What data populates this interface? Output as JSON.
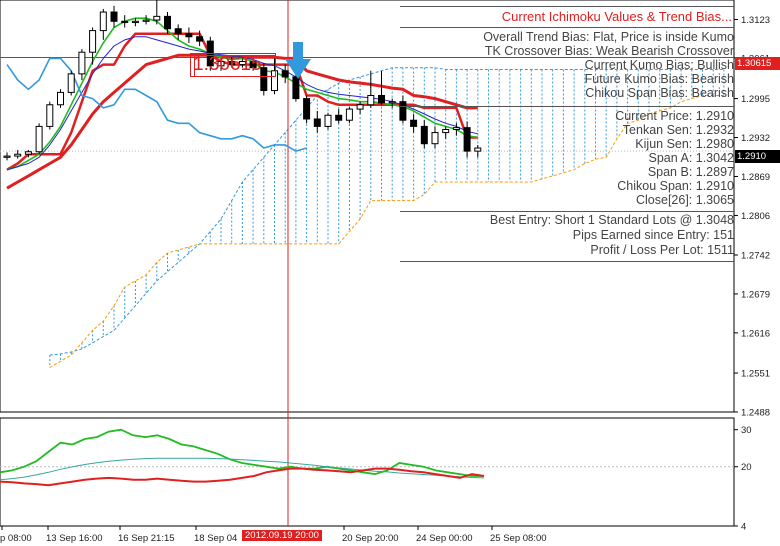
{
  "panel": {
    "title": "Current Ichimoku Values & Trend Bias...",
    "bias_lines": [
      "Overall Trend Bias: Flat, Price is inside Kumo",
      "TK Crossover Bias: Weak Bearish Crossover",
      "Current Kumo Bias: Bullish",
      "Future Kumo Bias: Bearish",
      "Chikou Span Bias: Bearish"
    ],
    "value_lines": [
      "Current Price: 1.2910",
      "Tenkan Sen: 1.2932",
      "Kijun Sen: 1.2980",
      "Span A: 1.3042",
      "Span B: 1.2897",
      "Chikou Span: 1.2910",
      "Close[26]: 1.3065"
    ],
    "entry_lines": [
      "Best Entry: Short 1 Standard Lots @ 1.3048",
      "Pips Earned since Entry: 151",
      "Profit / Loss Per Lot: 1511"
    ]
  },
  "entry_label": "1.30615",
  "crosshair_price": "1.30615",
  "current_price_tag": "1.2910",
  "crosshair_time": "2012.09.19 20:00",
  "colors": {
    "tenkan": "#e02020",
    "kijun": "#e02020",
    "green": "#22bb22",
    "blue": "#3399dd",
    "navy": "#2222cc",
    "kumo_span_a": "#3399dd",
    "kumo_span_b": "#ff9900",
    "crosshair": "#e02020"
  },
  "chart_data": [
    {
      "type": "candlestick",
      "y_axis_ticks": [
        1.3123,
        1.3061,
        1.2995,
        1.2932,
        1.2869,
        1.2806,
        1.2742,
        1.2679,
        1.2616,
        1.2551,
        1.2488
      ],
      "ylim": [
        1.2488,
        1.3148
      ],
      "x_axis_ticks": [
        "p 08:00",
        "13 Sep 16:00",
        "16 Sep 21:15",
        "18 Sep 04",
        "20 Sep 20:00",
        "24 Sep 00:00",
        "25 Sep 08:00"
      ],
      "candles": [
        [
          1.29,
          1.2908,
          1.2895,
          1.2902
        ],
        [
          1.2902,
          1.2912,
          1.2898,
          1.2905
        ],
        [
          1.2905,
          1.2912,
          1.29,
          1.2909
        ],
        [
          1.2909,
          1.2955,
          1.2905,
          1.295
        ],
        [
          1.295,
          1.299,
          1.2945,
          1.2985
        ],
        [
          1.2985,
          1.301,
          1.298,
          1.3005
        ],
        [
          1.3005,
          1.304,
          1.3,
          1.3035
        ],
        [
          1.3035,
          1.3075,
          1.3025,
          1.307
        ],
        [
          1.307,
          1.311,
          1.305,
          1.3105
        ],
        [
          1.3105,
          1.314,
          1.309,
          1.3135
        ],
        [
          1.3135,
          1.3145,
          1.311,
          1.312
        ],
        [
          1.312,
          1.313,
          1.311,
          1.3118
        ],
        [
          1.3118,
          1.3125,
          1.3112,
          1.312
        ],
        [
          1.312,
          1.313,
          1.3115,
          1.3122
        ],
        [
          1.3122,
          1.3155,
          1.3115,
          1.3128
        ],
        [
          1.3128,
          1.3135,
          1.31,
          1.3108
        ],
        [
          1.3108,
          1.3115,
          1.309,
          1.31
        ],
        [
          1.31,
          1.311,
          1.3085,
          1.3095
        ],
        [
          1.3095,
          1.3105,
          1.308,
          1.3088
        ],
        [
          1.3088,
          1.3095,
          1.304,
          1.3048
        ],
        [
          1.3048,
          1.306,
          1.304,
          1.3055
        ],
        [
          1.3055,
          1.3062,
          1.3045,
          1.305
        ],
        [
          1.305,
          1.306,
          1.3045,
          1.3055
        ],
        [
          1.3055,
          1.306,
          1.304,
          1.3045
        ],
        [
          1.3045,
          1.3052,
          1.3,
          1.3008
        ],
        [
          1.3008,
          1.306,
          1.3002,
          1.304
        ],
        [
          1.304,
          1.305,
          1.302,
          1.303
        ],
        [
          1.303,
          1.3035,
          1.299,
          1.2995
        ],
        [
          1.2995,
          1.3,
          1.2955,
          1.2962
        ],
        [
          1.2962,
          1.2975,
          1.294,
          1.295
        ],
        [
          1.295,
          1.2972,
          1.2945,
          1.2968
        ],
        [
          1.2968,
          1.2978,
          1.2955,
          1.296
        ],
        [
          1.296,
          1.2982,
          1.2955,
          1.2978
        ],
        [
          1.2978,
          1.299,
          1.297,
          1.2985
        ],
        [
          1.2985,
          1.304,
          1.298,
          1.3
        ],
        [
          1.3,
          1.304,
          1.2985,
          1.2988
        ],
        [
          1.2988,
          1.2995,
          1.298,
          1.299
        ],
        [
          1.299,
          1.3,
          1.2955,
          1.296
        ],
        [
          1.296,
          1.297,
          1.294,
          1.295
        ],
        [
          1.295,
          1.296,
          1.2915,
          1.2922
        ],
        [
          1.2922,
          1.295,
          1.2915,
          1.294
        ],
        [
          1.294,
          1.295,
          1.293,
          1.2945
        ],
        [
          1.2945,
          1.2955,
          1.2935,
          1.2948
        ],
        [
          1.2948,
          1.2958,
          1.29,
          1.291
        ],
        [
          1.291,
          1.292,
          1.29,
          1.2915
        ]
      ],
      "series": [
        {
          "values": [
            1.288,
            1.289,
            1.2905,
            1.2905,
            1.2905,
            1.2905,
            1.294,
            1.299,
            1.304,
            1.305,
            1.305,
            1.308,
            1.31,
            1.31,
            1.31,
            1.31,
            1.31,
            1.31,
            1.31,
            1.3065,
            1.3055,
            1.305,
            1.305,
            1.305,
            1.305,
            1.305,
            1.305,
            1.305,
            1.3,
            1.3,
            1.299,
            1.2985,
            1.2985,
            1.2985,
            1.2985,
            1.2985,
            1.2985,
            1.2985,
            1.2985,
            1.298,
            1.298,
            1.298,
            1.298,
            1.2932,
            1.2932
          ]
        },
        {
          "values": [
            1.285,
            1.286,
            1.287,
            1.288,
            1.289,
            1.29,
            1.292,
            1.2945,
            1.297,
            1.299,
            1.3005,
            1.302,
            1.3035,
            1.305,
            1.3055,
            1.306,
            1.3065,
            1.3065,
            1.3065,
            1.3065,
            1.3062,
            1.3062,
            1.3062,
            1.3062,
            1.3062,
            1.3062,
            1.306,
            1.306,
            1.304,
            1.3035,
            1.303,
            1.3025,
            1.3022,
            1.302,
            1.3018,
            1.3015,
            1.3012,
            1.301,
            1.3,
            1.2998,
            1.2995,
            1.299,
            1.2985,
            1.298,
            1.298
          ]
        },
        {
          "values": [
            1.288,
            1.2885,
            1.2895,
            1.2905,
            1.2925,
            1.295,
            1.2985,
            1.302,
            1.3055,
            1.3085,
            1.311,
            1.312,
            1.3125,
            1.3125,
            1.312,
            1.3105,
            1.309,
            1.308,
            1.3075,
            1.3068,
            1.3062,
            1.3058,
            1.306,
            1.3055,
            1.304,
            1.3038,
            1.303,
            1.302,
            1.301,
            1.3005,
            1.3,
            1.2995,
            1.2993,
            1.299,
            1.299,
            1.2988,
            1.2985,
            1.2982,
            1.2975,
            1.2965,
            1.2955,
            1.295,
            1.2945,
            1.2935,
            1.2932
          ]
        },
        {
          "values": [
            1.288,
            1.2885,
            1.289,
            1.29,
            1.292,
            1.2945,
            1.2975,
            1.3005,
            1.3035,
            1.306,
            1.308,
            1.309,
            1.3095,
            1.3095,
            1.309,
            1.3085,
            1.308,
            1.3075,
            1.3072,
            1.3068,
            1.3066,
            1.3064,
            1.3062,
            1.3058,
            1.3052,
            1.3048,
            1.304,
            1.303,
            1.3018,
            1.301,
            1.3005,
            1.3002,
            1.3,
            1.2998,
            1.2996,
            1.2994,
            1.299,
            1.2985,
            1.2978,
            1.297,
            1.2962,
            1.2955,
            1.295,
            1.2942,
            1.2938
          ]
        },
        {
          "values": [
            1.305,
            1.3025,
            1.301,
            1.3025,
            1.306,
            1.306,
            1.304,
            1.3,
            1.2995,
            1.298,
            1.2985,
            1.301,
            1.301,
            1.3,
            1.299,
            1.296,
            1.2955,
            1.2955,
            1.294,
            1.2935,
            1.293,
            1.293,
            1.2935,
            1.293,
            1.2915,
            1.292,
            1.292,
            1.291,
            1.2915
          ]
        }
      ],
      "kumo_a": [
        1.258,
        1.2582,
        1.2585,
        1.259,
        1.26,
        1.261,
        1.262,
        1.264,
        1.266,
        1.268,
        1.27,
        1.2715,
        1.273,
        1.2745,
        1.276,
        1.278,
        1.28,
        1.283,
        1.286,
        1.288,
        1.29,
        1.292,
        1.294,
        1.296,
        1.298,
        1.3,
        1.301,
        1.302,
        1.3025,
        1.303,
        1.3035,
        1.304,
        1.3045,
        1.3045,
        1.3045,
        1.3045,
        1.3045,
        1.3042,
        1.3042,
        1.3042,
        1.3042,
        1.3042,
        1.3042,
        1.3042,
        1.3042,
        1.3042,
        1.3042,
        1.3042,
        1.3042,
        1.3042,
        1.3042,
        1.3042,
        1.3042,
        1.3042,
        1.3042,
        1.3042,
        1.3042,
        1.3042,
        1.3042,
        1.3042,
        1.3042,
        1.3042,
        1.3042,
        1.3042,
        1.3042,
        1.3042
      ],
      "kumo_b": [
        1.256,
        1.257,
        1.258,
        1.26,
        1.262,
        1.2635,
        1.266,
        1.269,
        1.27,
        1.271,
        1.273,
        1.2745,
        1.275,
        1.2755,
        1.276,
        1.276,
        1.276,
        1.276,
        1.276,
        1.276,
        1.276,
        1.276,
        1.276,
        1.276,
        1.276,
        1.276,
        1.276,
        1.276,
        1.278,
        1.28,
        1.283,
        1.283,
        1.283,
        1.283,
        1.283,
        1.284,
        1.286,
        1.286,
        1.286,
        1.286,
        1.286,
        1.286,
        1.286,
        1.286,
        1.286,
        1.286,
        1.2865,
        1.287,
        1.2875,
        1.288,
        1.289,
        1.2897,
        1.29,
        1.293,
        1.2955,
        1.296,
        1.297,
        1.2975,
        1.298,
        1.299,
        1.2995,
        1.3,
        1.3,
        1.3,
        1.3,
        1.3
      ],
      "kumo_thick_b": [
        1.274,
        1.274,
        1.276,
        1.28,
        1.285,
        1.288,
        1.29,
        1.29,
        1.292,
        1.295
      ]
    },
    {
      "type": "line",
      "y_axis_ticks": [
        30,
        20,
        4
      ],
      "ylim": [
        4,
        31
      ],
      "series": [
        {
          "values": [
            18.5,
            19.0,
            20.0,
            21.5,
            24.0,
            26.5,
            26.0,
            27.5,
            28.0,
            29.5,
            30.0,
            28.5,
            28.0,
            28.5,
            27.5,
            26.0,
            25.5,
            24.5,
            23.5,
            22.0,
            21.0,
            20.5,
            20.0,
            19.5,
            20.0,
            19.5,
            19.5,
            20.0,
            19.5,
            19.0,
            18.5,
            18.0,
            19.0,
            21.0,
            20.5,
            20.0,
            19.0,
            18.5,
            18.0,
            17.5,
            17.5
          ]
        },
        {
          "values": [
            16.5,
            16.8,
            17.2,
            17.8,
            18.5,
            19.3,
            20.0,
            20.6,
            21.1,
            21.5,
            21.8,
            22.0,
            22.2,
            22.3,
            22.3,
            22.3,
            22.3,
            22.3,
            22.2,
            22.1,
            21.9,
            21.7,
            21.5,
            21.3,
            21.0,
            20.7,
            20.4,
            20.0,
            19.7,
            19.4,
            19.1,
            18.8,
            18.6,
            18.3,
            18.1,
            17.9,
            17.7,
            17.5,
            17.3,
            17.1,
            17.0
          ]
        },
        {
          "values": [
            16.0,
            15.8,
            15.5,
            15.3,
            15.0,
            15.5,
            16.0,
            16.5,
            16.8,
            17.0,
            16.8,
            16.5,
            16.5,
            16.8,
            16.5,
            16.2,
            16.0,
            16.0,
            16.2,
            16.5,
            17.0,
            17.5,
            18.5,
            19.0,
            19.5,
            19.5,
            19.2,
            19.0,
            18.8,
            18.5,
            19.0,
            19.5,
            19.5,
            19.2,
            18.8,
            18.5,
            18.0,
            17.5,
            17.0,
            18.0,
            17.5
          ]
        }
      ]
    }
  ]
}
